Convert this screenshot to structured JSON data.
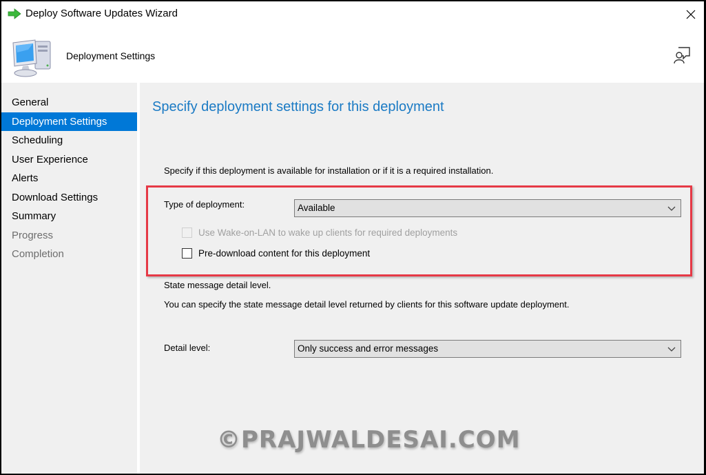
{
  "window": {
    "title": "Deploy Software Updates Wizard",
    "icons": {
      "title": "green-arrow-icon",
      "close": "close-icon",
      "header": "computer-icon",
      "help": "user-feedback-icon"
    }
  },
  "header": {
    "title": "Deployment Settings"
  },
  "sidebar": {
    "items": [
      {
        "label": "General",
        "state": "normal"
      },
      {
        "label": "Deployment Settings",
        "state": "active"
      },
      {
        "label": "Scheduling",
        "state": "normal"
      },
      {
        "label": "User Experience",
        "state": "normal"
      },
      {
        "label": "Alerts",
        "state": "normal"
      },
      {
        "label": "Download Settings",
        "state": "normal"
      },
      {
        "label": "Summary",
        "state": "normal"
      },
      {
        "label": "Progress",
        "state": "disabled"
      },
      {
        "label": "Completion",
        "state": "disabled"
      }
    ]
  },
  "main": {
    "heading": "Specify deployment settings for this deployment",
    "deployment_desc": "Specify if this deployment is available for installation or if it is a required installation.",
    "type_label": "Type of deployment:",
    "type_value": "Available",
    "wake_on_lan_label": "Use Wake-on-LAN to wake up clients for required deployments",
    "wake_on_lan_checked": false,
    "wake_on_lan_enabled": false,
    "predownload_label": "Pre-download content for this deployment",
    "predownload_checked": false,
    "state_heading": "State message detail level.",
    "state_desc": "You can specify the state message detail level returned by clients for this software update deployment.",
    "detail_label": "Detail level:",
    "detail_value": "Only success and error messages"
  },
  "watermark": "©PRAJWALDESAI.COM",
  "colors": {
    "accent": "#0078d7",
    "heading": "#1a7ac4",
    "highlight": "#e63946"
  }
}
